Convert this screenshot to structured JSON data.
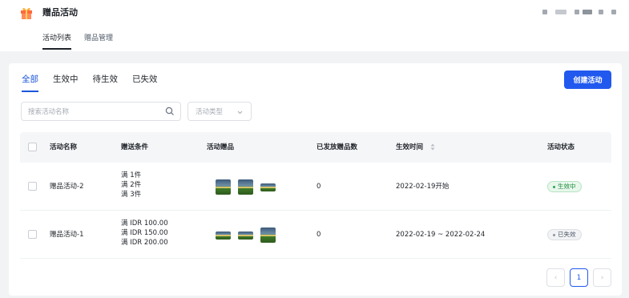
{
  "app": {
    "title": "赠品活动",
    "icon": "gift-icon"
  },
  "subnav": [
    {
      "label": "活动列表",
      "active": true
    },
    {
      "label": "赠品管理",
      "active": false
    }
  ],
  "tabs": [
    {
      "label": "全部",
      "active": true
    },
    {
      "label": "生效中",
      "active": false
    },
    {
      "label": "待生效",
      "active": false
    },
    {
      "label": "已失效",
      "active": false
    }
  ],
  "create_button": "创建活动",
  "search": {
    "placeholder": "搜索活动名称"
  },
  "type_select": {
    "placeholder": "活动类型"
  },
  "table": {
    "headers": [
      "活动名称",
      "赠送条件",
      "活动赠品",
      "已发放赠品数",
      "生效时间",
      "活动状态"
    ],
    "rows": [
      {
        "name": "赠品活动-2",
        "conditions": [
          "满 1件",
          "满 2件",
          "满 3件"
        ],
        "gift_count": "0",
        "time": "2022-02-19开始",
        "status": "生效中"
      },
      {
        "name": "赠品活动-1",
        "conditions": [
          "满 IDR 100.00",
          "满 IDR 150.00",
          "满 IDR 200.00"
        ],
        "gift_count": "0",
        "time": "2022-02-19 ~ 2022-02-24",
        "status": "已失效"
      }
    ]
  },
  "pagination": {
    "current": "1",
    "prev": "‹",
    "next": "›"
  },
  "colors": {
    "primary": "#2159ef",
    "active_status": "#1d8a3a"
  }
}
